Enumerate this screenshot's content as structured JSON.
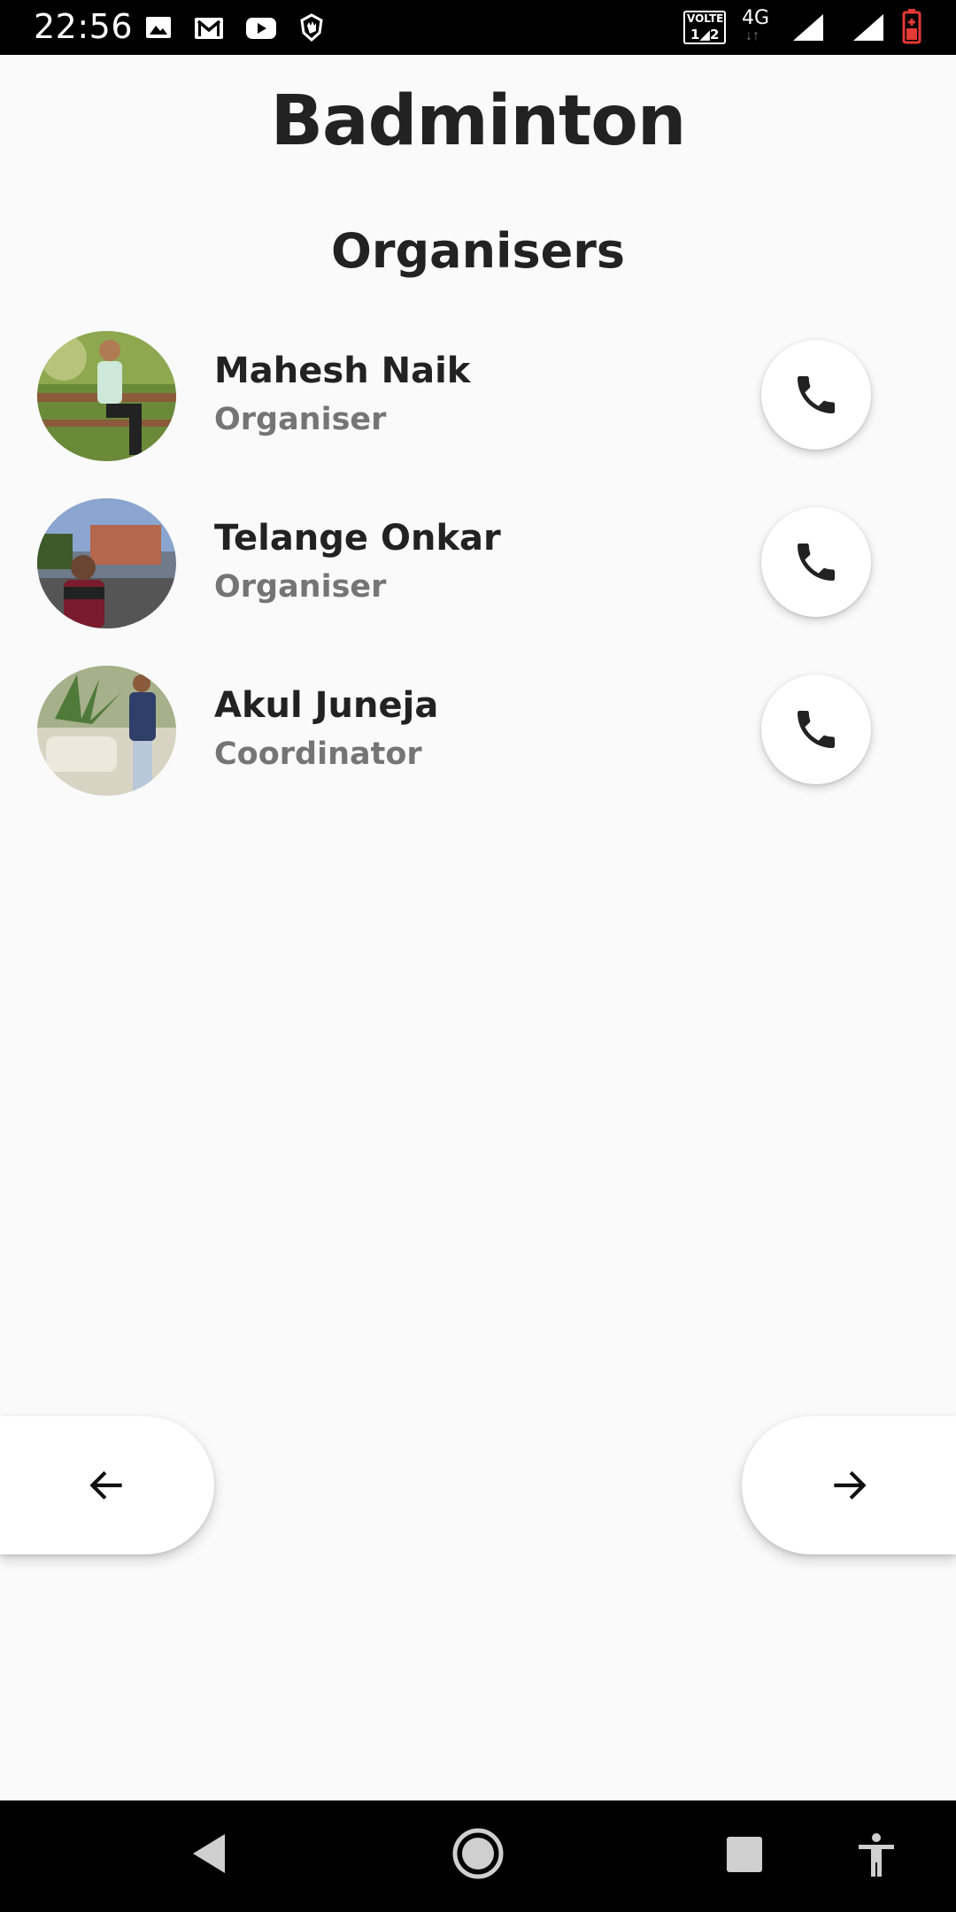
{
  "status_bar": {
    "time": "22:56",
    "left_icons": [
      "image-icon",
      "gmail-icon",
      "youtube-icon",
      "hand-shield-icon"
    ],
    "right_icons": [
      "volte-icon",
      "network-4g-icon",
      "signal-icon",
      "signal-icon",
      "battery-icon"
    ],
    "network_label": "4G",
    "volte_label": "VOLTE"
  },
  "page": {
    "title": "Badminton",
    "section_title": "Organisers"
  },
  "contacts": [
    {
      "name": "Mahesh Naik",
      "role": "Organiser"
    },
    {
      "name": "Telange Onkar",
      "role": "Organiser"
    },
    {
      "name": "Akul Juneja",
      "role": "Coordinator"
    }
  ],
  "navigation": {
    "prev_icon": "arrow-left-icon",
    "next_icon": "arrow-right-icon"
  },
  "system_nav": [
    "back-icon",
    "home-icon",
    "recents-icon",
    "accessibility-icon"
  ],
  "colors": {
    "background": "#fafafa",
    "text_primary": "#222222",
    "text_secondary": "#757575",
    "battery": "#e53935"
  }
}
